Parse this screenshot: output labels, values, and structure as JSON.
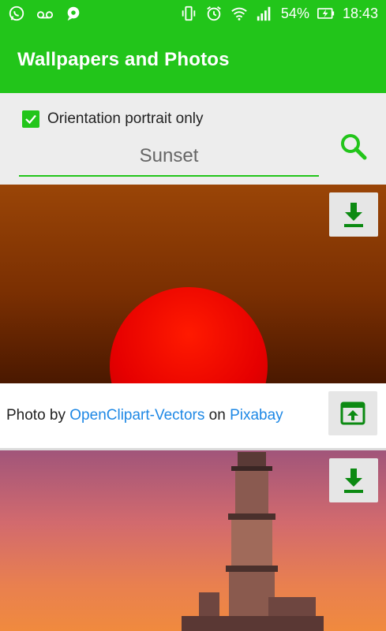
{
  "status_bar": {
    "battery": "54%",
    "time": "18:43",
    "icons": [
      "whatsapp-icon",
      "voicemail-icon",
      "chat-icon",
      "vibrate-icon",
      "alarm-icon",
      "wifi-icon",
      "signal-icon",
      "battery-charging-icon"
    ]
  },
  "app_bar": {
    "title": "Wallpapers and Photos"
  },
  "search_panel": {
    "checkbox_label": "Orientation portrait only",
    "checkbox_checked": true,
    "query": "Sunset"
  },
  "results": [
    {
      "credit_prefix": "Photo by",
      "author": "OpenClipart-Vectors",
      "credit_mid": "on",
      "source": "Pixabay"
    }
  ],
  "colors": {
    "accent": "#22c51a",
    "link": "#1e88e5",
    "download_icon": "#0c8a12"
  }
}
